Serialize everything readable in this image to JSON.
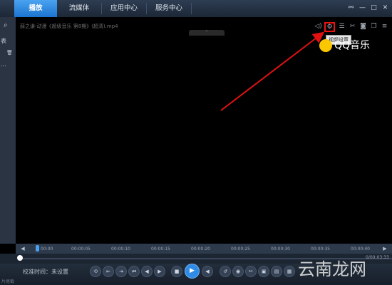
{
  "tabs": [
    {
      "label": "播放",
      "active": true
    },
    {
      "label": "流媒体",
      "active": false
    },
    {
      "label": "应用中心",
      "active": false
    },
    {
      "label": "服务中心",
      "active": false
    }
  ],
  "window_controls": {
    "skin": "⚯",
    "minimize": "—",
    "maximize": "□",
    "close": "✕"
  },
  "sidebar": {
    "search_icon": "⌕",
    "list_label": "表",
    "delete_icon": "🗑",
    "more": "..."
  },
  "video": {
    "filename": "薛之谦-动漫《超级音乐 第8期》(超清).mp4",
    "hide_panel_glyph": "⌃",
    "tooltip": "视频设置",
    "qq_brand": "QQ音乐"
  },
  "timeline": {
    "ticks": [
      "00:00",
      "00:00:05",
      "00:00:10",
      "00:00:15",
      "00:00:20",
      "00:00:25",
      "00:00:30",
      "00:00:35",
      "00:00:40"
    ],
    "left_arrow": "◀",
    "right_arrow": "▶"
  },
  "progress": {
    "total_time": "0/00:03:33",
    "fraction": 0.0
  },
  "controls": {
    "calibration_label": "校准时间：",
    "calibration_value": "未设置",
    "bottom_left": "片尾截"
  },
  "watermark": "云南龙网",
  "colors": {
    "accent": "#2f8be6",
    "highlight_box": "#e11111",
    "arrow": "#e11111",
    "qq_yellow": "#fbc700"
  }
}
